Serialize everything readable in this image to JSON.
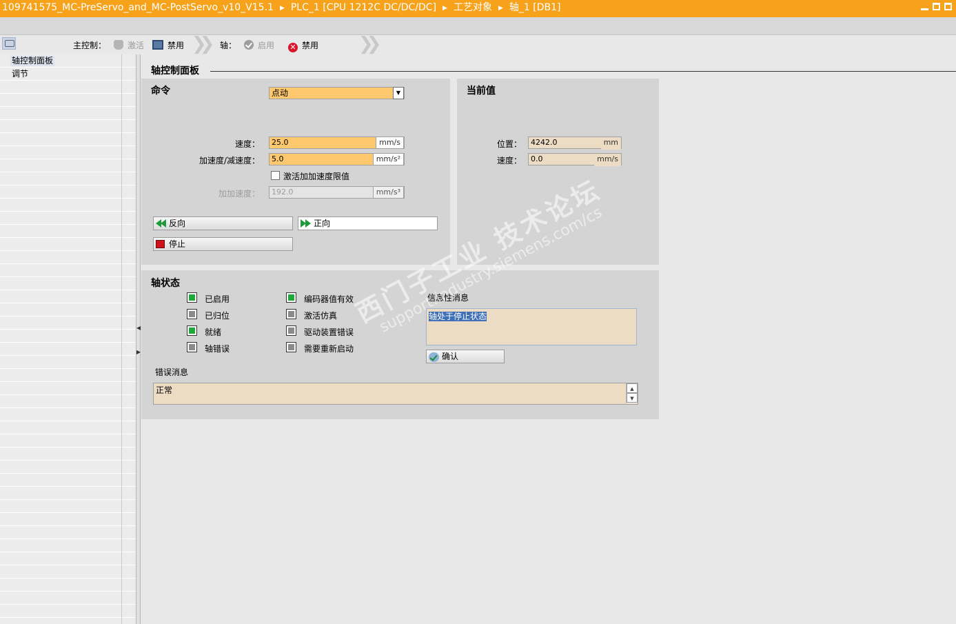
{
  "titlebar": {
    "crumbs": [
      "109741575_MC-PreServo_and_MC-PostServo_v10_V15.1",
      "PLC_1 [CPU 1212C DC/DC/DC]",
      "工艺对象",
      "轴_1 [DB1]"
    ]
  },
  "toolbar": {
    "master_label": "主控制：",
    "activate_label": "激活",
    "disable_master_label": "禁用",
    "axis_label": "轴：",
    "enable_label": "启用",
    "disable_axis_label": "禁用"
  },
  "sidebar": {
    "items": [
      {
        "label": "轴控制面板",
        "selected": true
      },
      {
        "label": "调节",
        "selected": false
      }
    ]
  },
  "panel": {
    "title": "轴控制面板"
  },
  "command": {
    "heading": "命令",
    "mode_selected": "点动",
    "speed_label": "速度：",
    "speed_value": "25.0",
    "speed_unit": "mm/s",
    "accel_label": "加速度/减速度：",
    "accel_value": "5.0",
    "accel_unit": "mm/s²",
    "jerk_checkbox_label": "激活加加速度限值",
    "jerk_checked": false,
    "jerk_label": "加加速度：",
    "jerk_value": "192.0",
    "jerk_unit": "mm/s³",
    "backward_label": "反向",
    "forward_label": "正向",
    "stop_label": "停止"
  },
  "current": {
    "heading": "当前值",
    "position_label": "位置：",
    "position_value": "4242.0",
    "position_unit": "mm",
    "velocity_label": "速度：",
    "velocity_value": "0.0",
    "velocity_unit": "mm/s"
  },
  "axis_status": {
    "heading": "轴状态",
    "col1": [
      {
        "label": "已启用",
        "state": "on"
      },
      {
        "label": "已归位",
        "state": "off"
      },
      {
        "label": "就绪",
        "state": "on"
      },
      {
        "label": "轴错误",
        "state": "off"
      }
    ],
    "col2": [
      {
        "label": "编码器值有效",
        "state": "on"
      },
      {
        "label": "激活仿真",
        "state": "off"
      },
      {
        "label": "驱动装置错误",
        "state": "off"
      },
      {
        "label": "需要重新启动",
        "state": "off"
      }
    ],
    "info_label": "信息性消息",
    "info_message": "轴处于停止状态",
    "ack_label": "确认",
    "error_label": "错误消息",
    "error_message": "正常"
  },
  "watermark": {
    "line1": "西门子工业 技术论坛",
    "line2": "support.industry.siemens.com/cs"
  },
  "colors": {
    "title_bar": "#f7a21b",
    "input_field": "#fec96e",
    "readonly_field": "#ecdcc4",
    "led_on": "#1fa83a",
    "stop": "#d0101b"
  }
}
